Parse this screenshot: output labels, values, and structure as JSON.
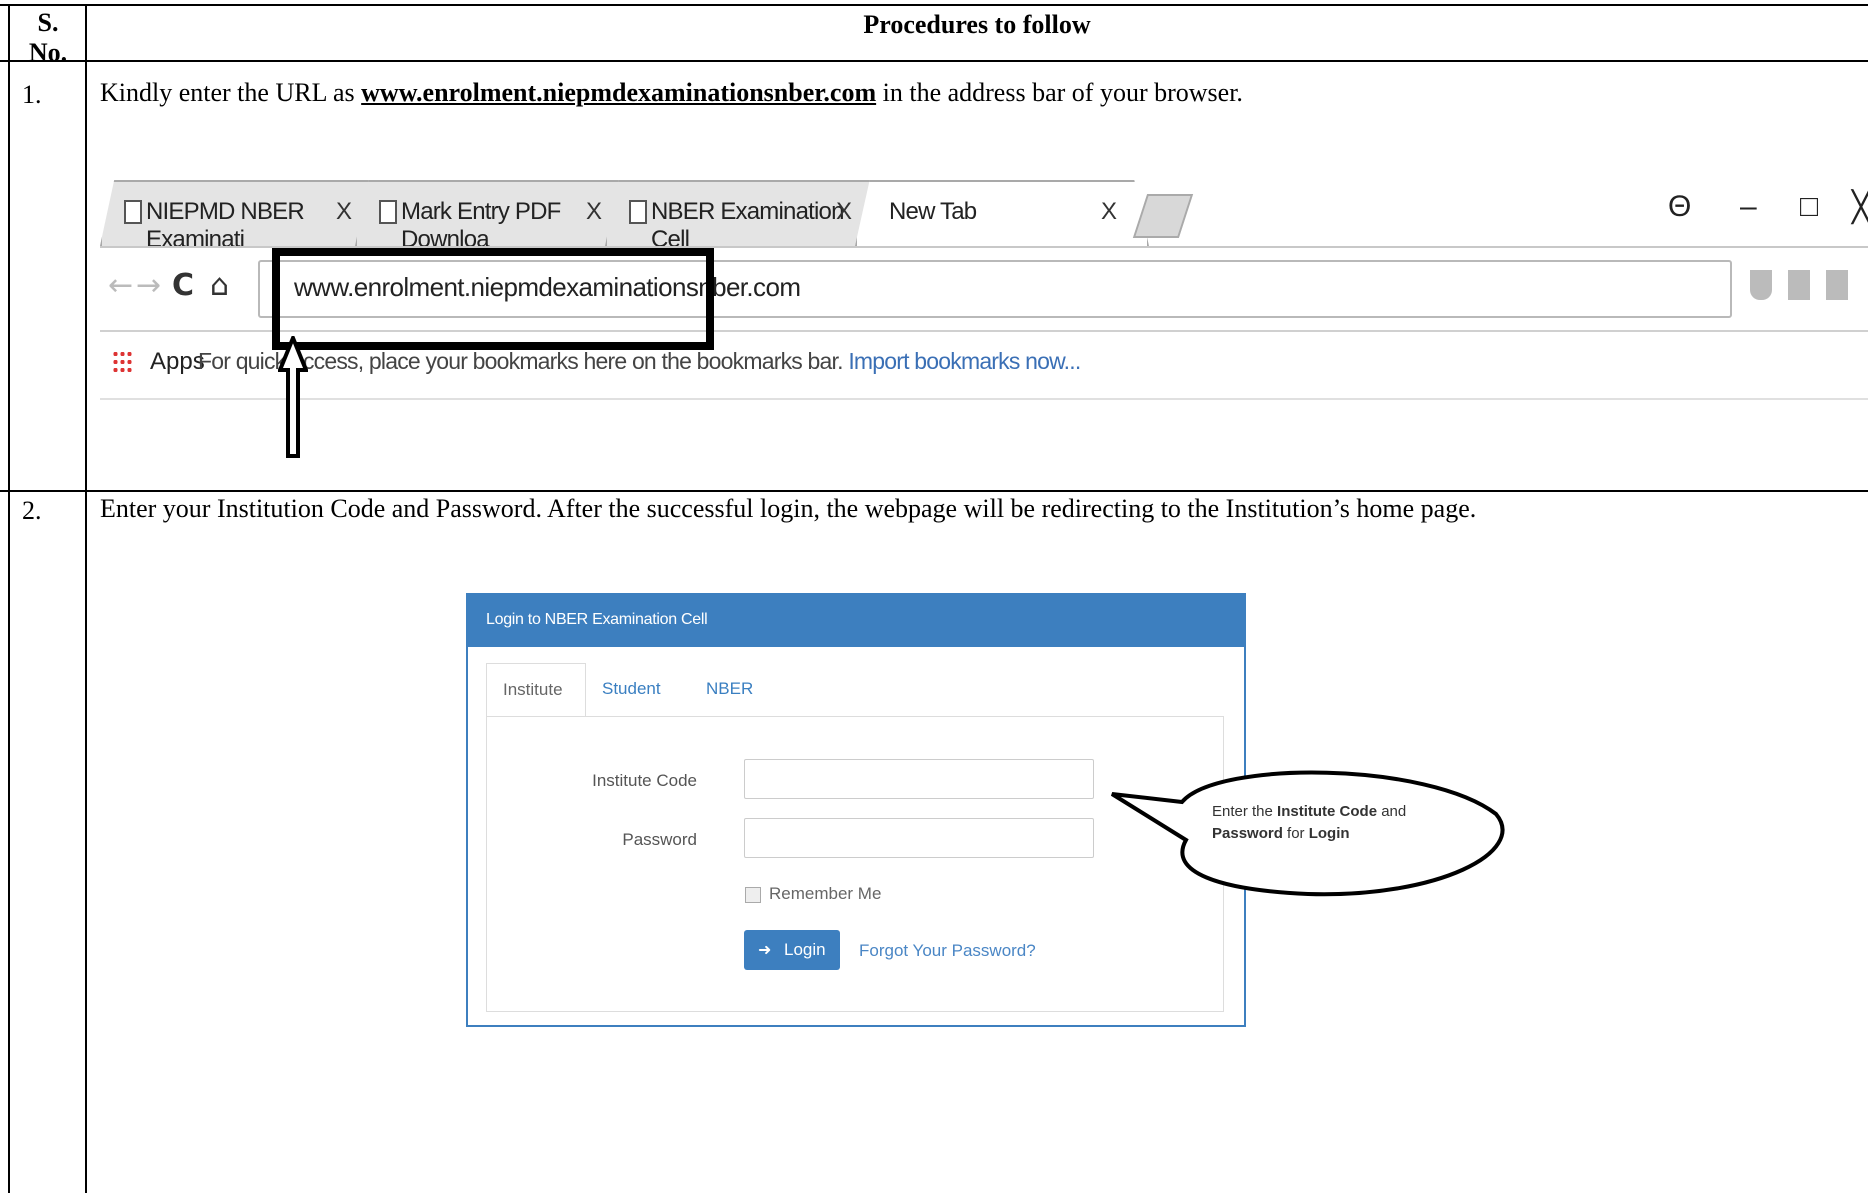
{
  "table": {
    "header_sno": "S. No.",
    "header_procedures": "Procedures to follow",
    "rows": [
      {
        "sno": "1.",
        "text_before": "Kindly enter the URL as ",
        "url": "www.enrolment.niepmdexaminationsnber.com",
        "text_after": " in the address bar of your browser."
      },
      {
        "sno": "2.",
        "text": "Enter your Institution Code and Password. After the successful login, the webpage will be redirecting to the Institution’s home page."
      }
    ]
  },
  "browser": {
    "tabs": [
      {
        "label": "NIEPMD NBER Examinati",
        "close": "X"
      },
      {
        "label": "Mark Entry PDF Downloa",
        "close": "X"
      },
      {
        "label": "NBER Examination Cell",
        "close": "X"
      },
      {
        "label": "New Tab",
        "close": "X"
      }
    ],
    "address_url": "www.enrolment.niepmdexaminationsnber.com",
    "bookmarks": {
      "apps_label": "Apps",
      "hint": "For quick access, place your bookmarks here on the bookmarks bar. ",
      "import_link": "Import bookmarks now..."
    }
  },
  "login": {
    "panel_title": "Login to NBER Examination Cell",
    "tabs": [
      "Institute",
      "Student",
      "NBER"
    ],
    "institute_code_label": "Institute Code",
    "password_label": "Password",
    "remember_label": "Remember Me",
    "login_button": "Login",
    "forgot_link": "Forgot Your Password?",
    "callout_line1_a": "Enter the ",
    "callout_line1_b": "Institute Code",
    "callout_line1_c": " and",
    "callout_line2_a": "Password",
    "callout_line2_b": " for ",
    "callout_line2_c": "Login"
  }
}
